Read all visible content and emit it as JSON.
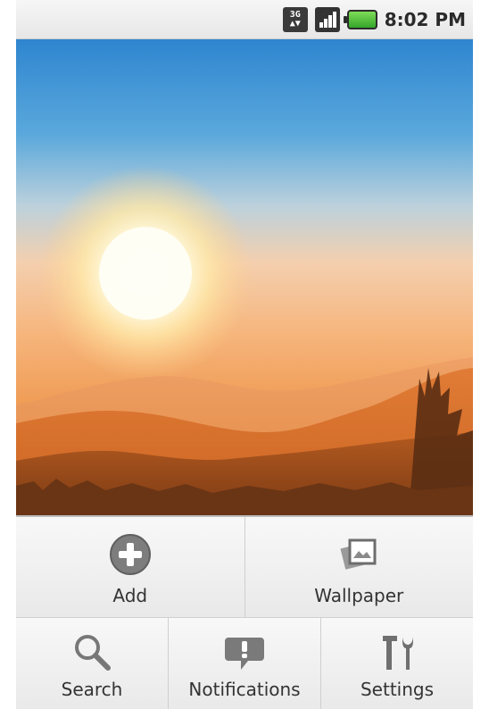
{
  "status_bar": {
    "network_top": "3G",
    "network_bottom": "▲▼",
    "time": "8:02 PM"
  },
  "menu": {
    "row1": [
      {
        "label": "Add",
        "icon": "add-icon"
      },
      {
        "label": "Wallpaper",
        "icon": "wallpaper-icon"
      }
    ],
    "row2": [
      {
        "label": "Search",
        "icon": "search-icon"
      },
      {
        "label": "Notifications",
        "icon": "notifications-icon"
      },
      {
        "label": "Settings",
        "icon": "settings-icon"
      }
    ]
  },
  "colors": {
    "battery": "#34a52a",
    "icon_gray": "#7a7a7a"
  }
}
